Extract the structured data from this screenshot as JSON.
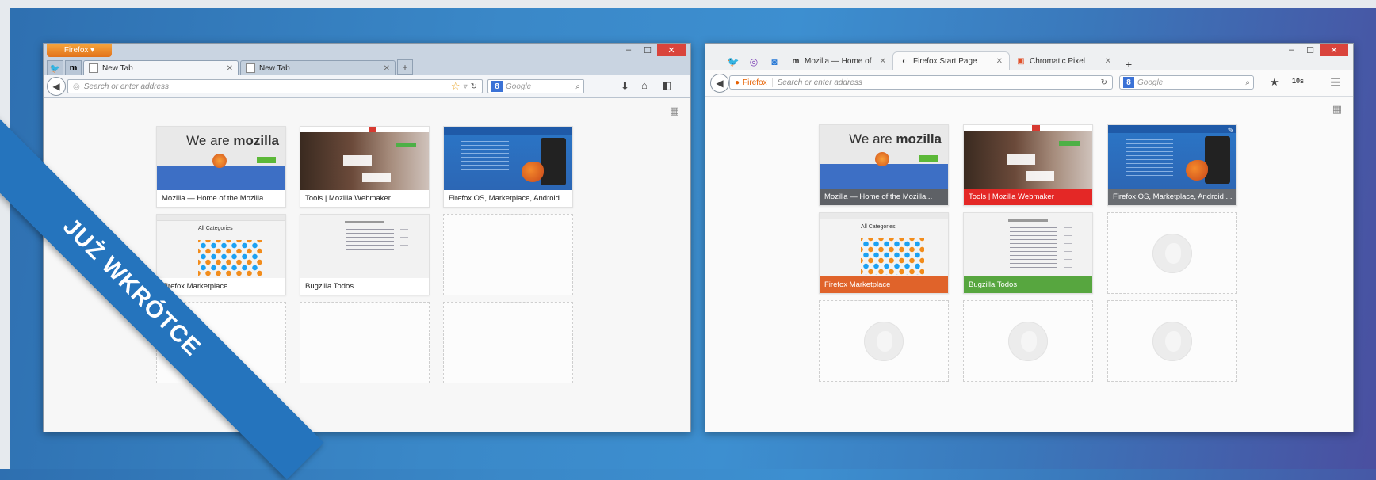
{
  "ribbon": {
    "label": "JUŻ WKRÓTCE"
  },
  "old_window": {
    "menu_button": "Firefox ▾",
    "tabs": [
      {
        "label": "New Tab",
        "active": true
      },
      {
        "label": "New Tab",
        "active": false
      }
    ],
    "url_placeholder": "Search or enter address",
    "search_engine": "8",
    "search_placeholder": "Google",
    "tiles": [
      {
        "title": "Mozilla — Home of the Mozilla...",
        "thumb": "mozilla"
      },
      {
        "title": "Tools | Mozilla Webmaker",
        "thumb": "webmaker"
      },
      {
        "title": "Firefox OS, Marketplace, Android ...",
        "thumb": "firefoxos"
      },
      {
        "title": "Firefox Marketplace",
        "thumb": "market",
        "thumb_text": "All Categories"
      },
      {
        "title": "Bugzilla Todos",
        "thumb": "bugzilla"
      }
    ]
  },
  "new_window": {
    "pinned_tabs": [
      "twitter",
      "o",
      "c"
    ],
    "tabs": [
      {
        "label": "Mozilla — Home of",
        "active": false
      },
      {
        "label": "Firefox Start Page",
        "active": true
      },
      {
        "label": "Chromatic Pixel",
        "active": false
      }
    ],
    "identity_label": "Firefox",
    "url_placeholder": "Search or enter address",
    "search_engine": "8",
    "search_placeholder": "Google",
    "toolbar_badge": "10s",
    "tiles": [
      {
        "title": "Mozilla — Home of the Mozilla...",
        "bar_color": "#5e6166"
      },
      {
        "title": "Tools | Mozilla Webmaker",
        "bar_color": "#e42826"
      },
      {
        "title": "Firefox OS, Marketplace, Android ...",
        "bar_color": "#6a6d72"
      },
      {
        "title": "Firefox Marketplace",
        "bar_color": "#e0632a",
        "thumb_text": "All Categories"
      },
      {
        "title": "Bugzilla Todos",
        "bar_color": "#57a63f"
      }
    ]
  },
  "colors": {
    "background_gradient": [
      "#2e6fb0",
      "#3d8fd0",
      "#4a4fa0"
    ],
    "ribbon": "#2574bd",
    "close_button": "#d9443c",
    "firefox_button": "#e2721b"
  }
}
